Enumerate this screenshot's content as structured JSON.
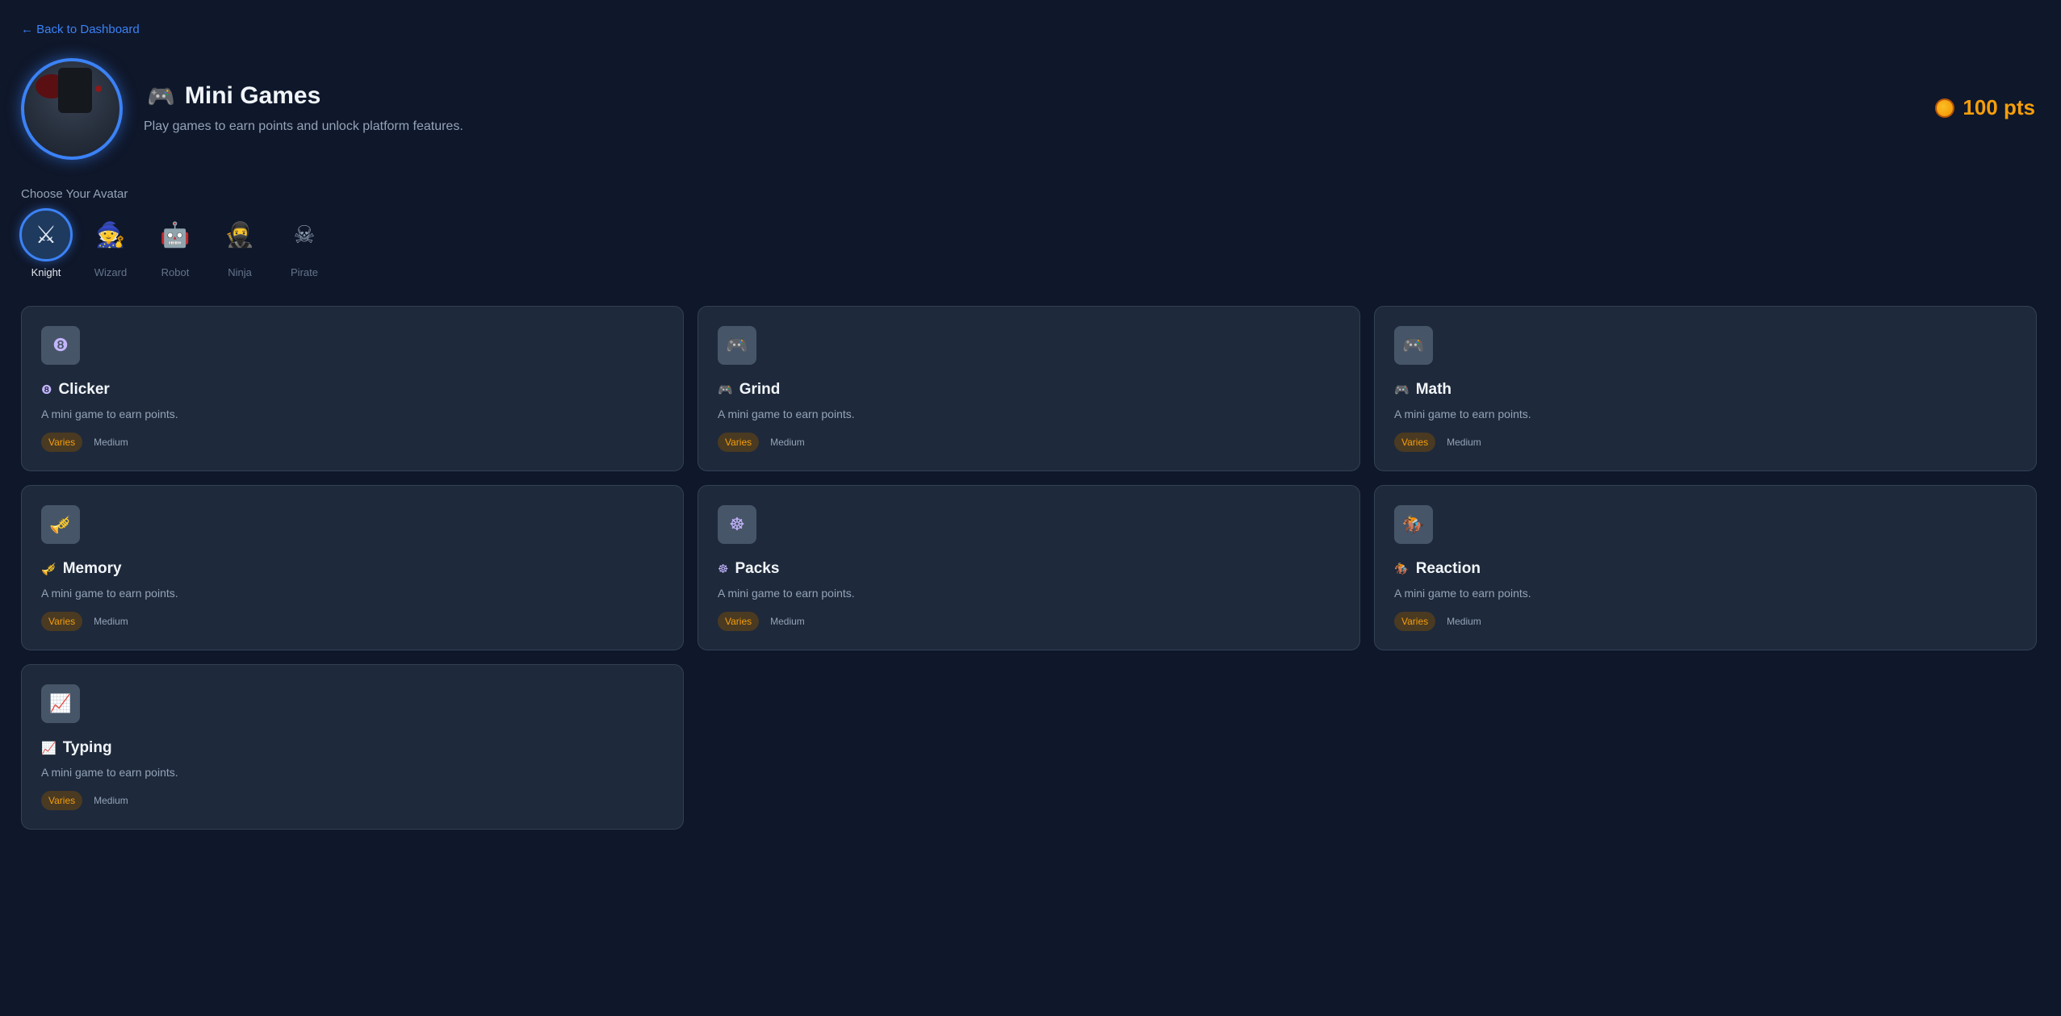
{
  "nav": {
    "back_label": "← Back to Dashboard"
  },
  "header": {
    "title_icon": "gamepad-icon",
    "title": "Mini Games",
    "subtitle": "Play games to earn points and unlock platform features.",
    "points": "100 pts"
  },
  "avatar_picker": {
    "label": "Choose Your Avatar",
    "options": [
      {
        "name": "Knight",
        "glyph": "⚔",
        "selected": true
      },
      {
        "name": "Wizard",
        "glyph": "🧙",
        "selected": false
      },
      {
        "name": "Robot",
        "glyph": "🤖",
        "selected": false
      },
      {
        "name": "Ninja",
        "glyph": "🥷",
        "selected": false
      },
      {
        "name": "Pirate",
        "glyph": "☠",
        "selected": false
      }
    ]
  },
  "games": [
    {
      "title": "Clicker",
      "icon": "eight-ball-icon",
      "glyph": "❽",
      "desc": "A mini game to earn points.",
      "tag": "Varies",
      "difficulty": "Medium"
    },
    {
      "title": "Grind",
      "icon": "gamepad-icon",
      "glyph": "🎮",
      "desc": "A mini game to earn points.",
      "tag": "Varies",
      "difficulty": "Medium"
    },
    {
      "title": "Math",
      "icon": "gamepad-icon",
      "glyph": "🎮",
      "desc": "A mini game to earn points.",
      "tag": "Varies",
      "difficulty": "Medium"
    },
    {
      "title": "Memory",
      "icon": "trumpet-icon",
      "glyph": "🎺",
      "desc": "A mini game to earn points.",
      "tag": "Varies",
      "difficulty": "Medium"
    },
    {
      "title": "Packs",
      "icon": "wheel-icon",
      "glyph": "☸",
      "desc": "A mini game to earn points.",
      "tag": "Varies",
      "difficulty": "Medium"
    },
    {
      "title": "Reaction",
      "icon": "horse-racing-icon",
      "glyph": "🏇",
      "desc": "A mini game to earn points.",
      "tag": "Varies",
      "difficulty": "Medium"
    },
    {
      "title": "Typing",
      "icon": "chart-icon",
      "glyph": "📈",
      "desc": "A mini game to earn points.",
      "tag": "Varies",
      "difficulty": "Medium"
    }
  ],
  "colors": {
    "background": "#0f172a",
    "card": "#1e293b",
    "accent": "#3b82f6",
    "points": "#f59e0b"
  }
}
